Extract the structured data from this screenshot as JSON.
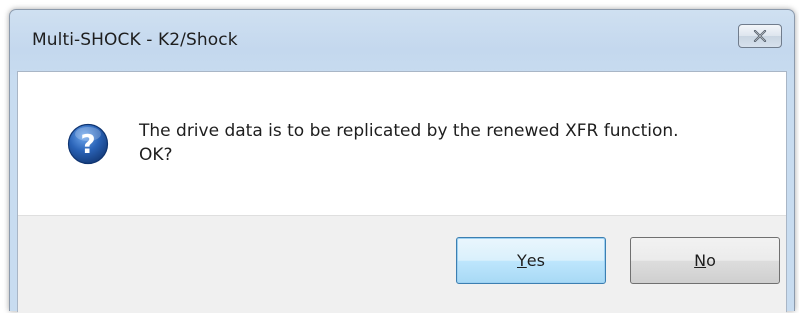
{
  "window": {
    "title": "Multi-SHOCK - K2/Shock",
    "close_icon": "close-x-icon"
  },
  "message": {
    "icon": "question-mark-icon",
    "line1": "The drive data is to be replicated by the renewed XFR function.",
    "line2": "OK?"
  },
  "buttons": {
    "yes": {
      "accel": "Y",
      "rest": "es"
    },
    "no": {
      "accel": "N",
      "rest": "o"
    }
  },
  "colors": {
    "title_bar": "#c8dcf0",
    "icon_blue": "#2a63b7",
    "default_button_border": "#3c7fb1"
  }
}
